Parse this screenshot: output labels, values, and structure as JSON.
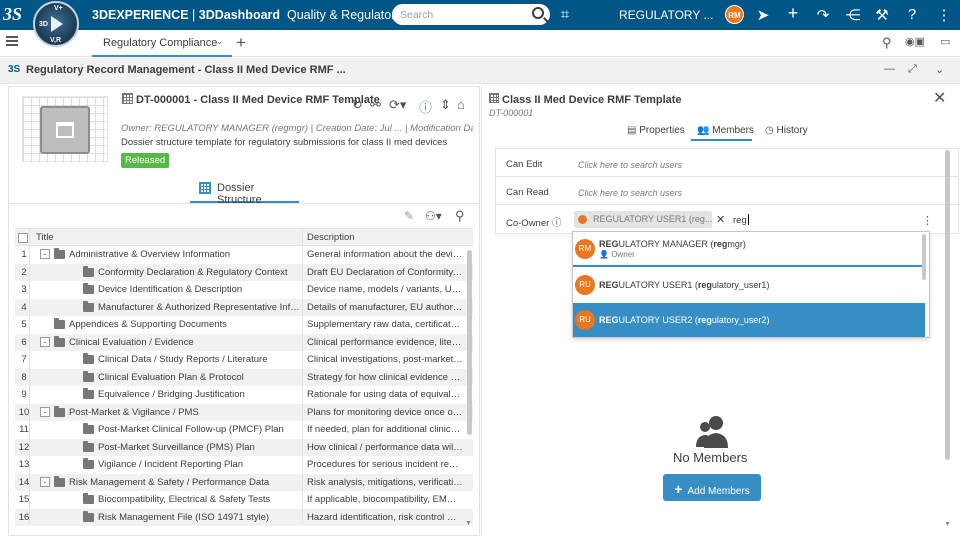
{
  "topbar": {
    "brand": "3DEXPERIENCE",
    "dashboard": "3DDashboard",
    "app_name": "Quality & Regulatory",
    "search_placeholder": "Search",
    "username": "REGULATORY ...",
    "avatar_initials": "RM",
    "compass_labels": {
      "left": "3D",
      "top": "V+",
      "bottom": "V,R"
    },
    "icons": [
      "search-icon",
      "tag-icon",
      "user-avatar",
      "collaborate-icon",
      "add-icon",
      "share-icon",
      "network-icon",
      "applications-icon",
      "help-icon",
      "more-icon"
    ]
  },
  "tabbar": {
    "active_tab": "Regulatory Compliance",
    "add_tab": "+"
  },
  "widget": {
    "title": "Regulatory Record Management - Class II Med Device RMF ..."
  },
  "object": {
    "title": "DT-000001 - Class II Med Device RMF Template",
    "meta": "Owner: REGULATORY MANAGER (regmgr)  |  Creation Date: Jul ...  |  Modification Date: Jul ...",
    "description": "Dossier structure template for regulatory submissions for class II med devices",
    "status": "Released"
  },
  "dossier_tab": "Dossier Structure",
  "table": {
    "headers": {
      "title": "Title",
      "description": "Description"
    },
    "rows": [
      {
        "num": "1",
        "title": "Administrative & Overview Information",
        "desc": "General information about the device, ma...",
        "level": 0,
        "expander": "-"
      },
      {
        "num": "2",
        "title": "Conformity Declaration & Regulatory Context",
        "desc": "Draft EU Declaration of Conformity, appli...",
        "level": 1,
        "expander": ""
      },
      {
        "num": "3",
        "title": "Device Identification & Description",
        "desc": "Device name, models / variants, UDI / ba...",
        "level": 1,
        "expander": ""
      },
      {
        "num": "4",
        "title": "Manufacturer & Authorized Representative Information",
        "desc": "Details of manufacturer, EU authorized re...",
        "level": 1,
        "expander": ""
      },
      {
        "num": "5",
        "title": "Appendices & Supporting Documents",
        "desc": "Supplementary raw data, certificates, cali...",
        "level": 0,
        "expander": ""
      },
      {
        "num": "6",
        "title": "Clinical Evaluation / Evidence",
        "desc": "Clinical performance evidence, literature,...",
        "level": 0,
        "expander": "-"
      },
      {
        "num": "7",
        "title": "Clinical Data / Study Reports / Literature",
        "desc": "Clinical investigations, post-market data, ...",
        "level": 1,
        "expander": ""
      },
      {
        "num": "8",
        "title": "Clinical Evaluation Plan & Protocol",
        "desc": "Strategy for how clinical evidence will be ...",
        "level": 1,
        "expander": ""
      },
      {
        "num": "9",
        "title": "Equivalence / Bridging Justification",
        "desc": "Rationale for using data of equivalent de...",
        "level": 1,
        "expander": ""
      },
      {
        "num": "10",
        "title": "Post-Market & Vigilance / PMS",
        "desc": "Plans for monitoring device once on mar...",
        "level": 0,
        "expander": "-"
      },
      {
        "num": "11",
        "title": "Post-Market Clinical Follow-up (PMCF) Plan",
        "desc": "If needed, plan for additional clinical data...",
        "level": 1,
        "expander": ""
      },
      {
        "num": "12",
        "title": "Post-Market Surveillance (PMS) Plan",
        "desc": "How clinical / performance data will be co...",
        "level": 1,
        "expander": ""
      },
      {
        "num": "13",
        "title": "Vigilance / Incident Reporting Plan",
        "desc": "Procedures for serious incident reporting,...",
        "level": 1,
        "expander": ""
      },
      {
        "num": "14",
        "title": "Risk Management & Safety / Performance Data",
        "desc": "Risk analysis, mitigations, verification / v...",
        "level": 0,
        "expander": "-"
      },
      {
        "num": "15",
        "title": "Biocompatibility, Electrical & Safety Tests",
        "desc": "If applicable, biocompatibility, EMC, elect...",
        "level": 1,
        "expander": ""
      },
      {
        "num": "16",
        "title": "Risk Management File (ISO 14971 style)",
        "desc": "Hazard identification, risk control measur...",
        "level": 1,
        "expander": ""
      }
    ]
  },
  "right": {
    "title": "Class II Med Device RMF Template",
    "subtitle": "DT-000001",
    "tabs": {
      "properties": "Properties",
      "members": "Members",
      "history": "History"
    },
    "access": {
      "can_edit": "Can Edit",
      "can_edit_placeholder": "Click here to search users",
      "can_read": "Can Read",
      "can_read_placeholder": "Click here to search users",
      "co_owner": "Co-Owner",
      "chip": "REGULATORY USER1 (reg...",
      "typed": "reg"
    },
    "dropdown": [
      {
        "initials": "RM",
        "match": "REG",
        "rest": "ULATORY MANAGER (",
        "match2": "reg",
        "rest2": "mgr)",
        "sub": "Owner"
      },
      {
        "initials": "RU",
        "match": "REG",
        "rest": "ULATORY USER1 (",
        "match2": "reg",
        "rest2": "ulatory_user1)",
        "sub": ""
      },
      {
        "initials": "RU",
        "match": "REG",
        "rest": "ULATORY USER2 (",
        "match2": "reg",
        "rest2": "ulatory_user2)",
        "sub": ""
      }
    ],
    "no_members": "No Members",
    "add_members": "Add Members"
  },
  "colors": {
    "topbar": "#005686",
    "accent": "#368ec4",
    "released": "#57b847",
    "avatar": "#e87722"
  }
}
